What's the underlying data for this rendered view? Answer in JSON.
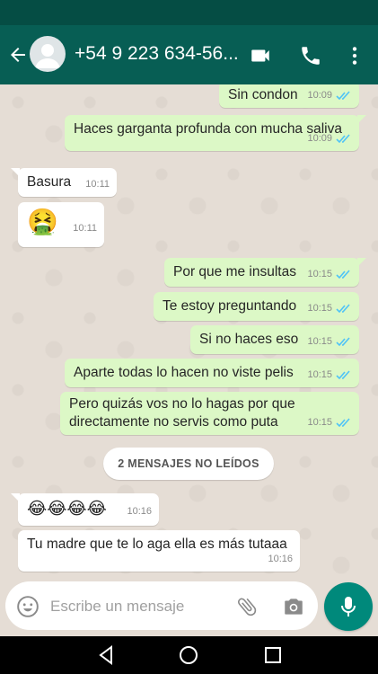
{
  "header": {
    "contact_name": "+54 9 223 634-56...",
    "back_icon": "arrow-back-icon",
    "video_icon": "video-call-icon",
    "call_icon": "phone-icon",
    "menu_icon": "more-vert-icon",
    "accent": "#075e54"
  },
  "messages": [
    {
      "dir": "out",
      "text": "Sin condon",
      "time": "10:09",
      "ticks": "read"
    },
    {
      "dir": "out",
      "text": "Haces garganta profunda con mucha saliva",
      "time": "10:09",
      "ticks": "read"
    },
    {
      "dir": "in",
      "text": "Basura",
      "time": "10:11"
    },
    {
      "dir": "in",
      "text": "🤮",
      "time": "10:11"
    },
    {
      "dir": "out",
      "text": "Por que me insultas",
      "time": "10:15",
      "ticks": "read"
    },
    {
      "dir": "out",
      "text": "Te estoy preguntando",
      "time": "10:15",
      "ticks": "read"
    },
    {
      "dir": "out",
      "text": "Si no haces eso",
      "time": "10:15",
      "ticks": "read"
    },
    {
      "dir": "out",
      "text": "Aparte todas lo hacen no viste pelis",
      "time": "10:15",
      "ticks": "read"
    },
    {
      "dir": "out",
      "text_line1": "Pero quizás vos no lo hagas por que",
      "text_line2": "directamente no servis como puta",
      "time": "10:15",
      "ticks": "read"
    },
    {
      "dir": "in",
      "text": "😂😂😂😂",
      "time": "10:16"
    },
    {
      "dir": "in",
      "text": "Tu madre que te lo aga ella es más tutaaa",
      "time": "10:16"
    }
  ],
  "unread_banner": "2 MENSAJES NO LEÍDOS",
  "composer": {
    "placeholder": "Escribe un mensaje",
    "emoji_icon": "emoji-icon",
    "attach_icon": "paperclip-icon",
    "camera_icon": "camera-icon",
    "mic_icon": "microphone-icon"
  },
  "colors": {
    "outgoing_bubble": "#dcf8c6",
    "incoming_bubble": "#ffffff",
    "read_ticks": "#4fc3f7",
    "fab": "#00897b"
  }
}
